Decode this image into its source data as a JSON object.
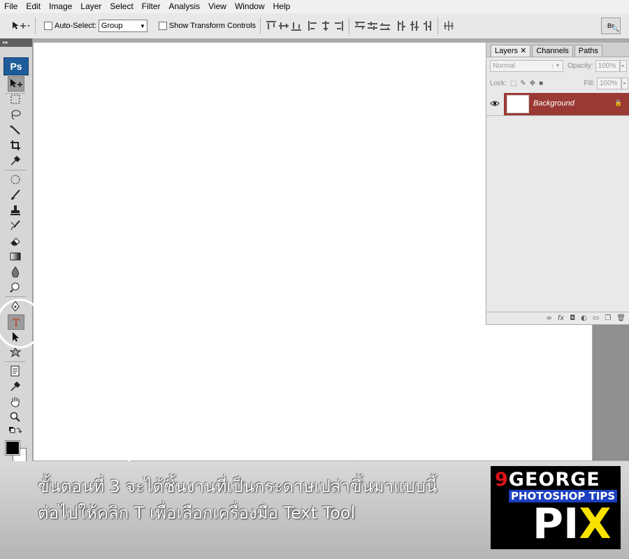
{
  "menu": [
    "File",
    "Edit",
    "Image",
    "Layer",
    "Select",
    "Filter",
    "Analysis",
    "View",
    "Window",
    "Help"
  ],
  "options": {
    "auto_select_label": "Auto-Select:",
    "auto_select_value": "Group",
    "show_transform_label": "Show Transform Controls",
    "bridge_label": "Br"
  },
  "toolbox": {
    "logo": "Ps",
    "active_tool": "text-tool"
  },
  "layers_panel": {
    "tabs": [
      "Layers",
      "Channels",
      "Paths"
    ],
    "blend_mode": "Normal",
    "opacity_label": "Opacity:",
    "opacity_value": "100%",
    "lock_label": "Lock:",
    "fill_label": "Fill:",
    "fill_value": "100%",
    "layer_name": "Background"
  },
  "caption": {
    "line1": "ขั้นตอนที่ 3 จะได้ชิ้นงานที่เป็นกระดาษเปล่าขึ้นมาแบบนี้",
    "line2": "ต่อไปให้คลิก T เพื่อเลือกเครื่องมือ Text Tool"
  },
  "logo": {
    "line1_accent": "9",
    "line1": "GEORGE",
    "line2": "PHOTOSHOP TIPS",
    "line3_a": "PI",
    "line3_b": "X"
  },
  "colors": {
    "selected_layer": "#9b3a34",
    "logo_accent": "#e0121b",
    "logo_band": "#1c3fbf",
    "logo_x": "#f7e200"
  }
}
